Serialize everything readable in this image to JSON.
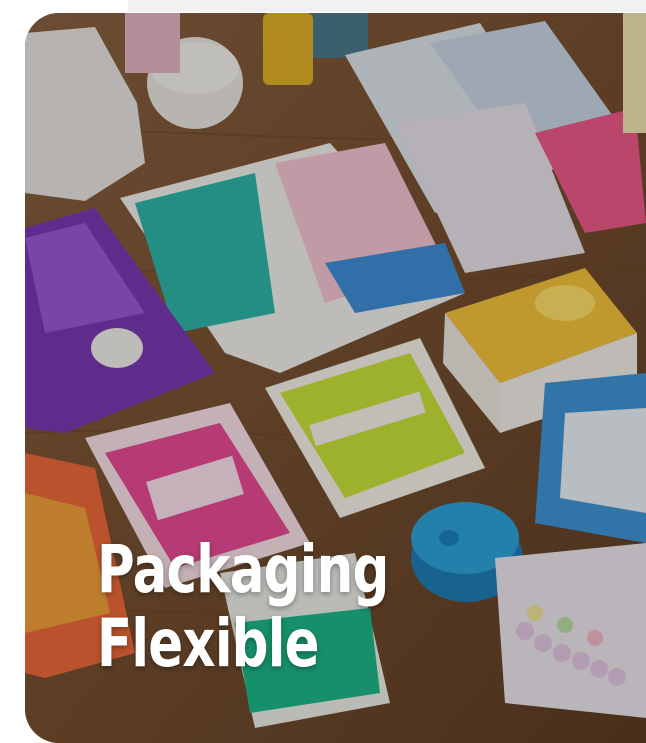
{
  "card": {
    "title_line1": "Packaging",
    "title_line2": "Flexible",
    "image_icon": "photo-of-flexible-pharma-packaging"
  },
  "colors": {
    "table_wood": "#7a5434",
    "title_text": "#ffffff",
    "top_strip": "#f2f1f1"
  }
}
